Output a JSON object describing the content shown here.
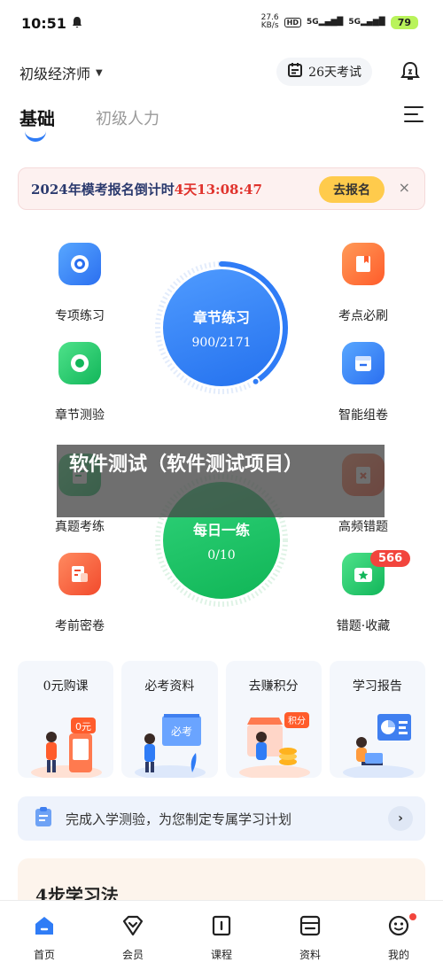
{
  "status_bar": {
    "time": "10:51",
    "net_speed": "27.6",
    "net_unit": "KB/s",
    "hd": "HD",
    "signal_1": "5G",
    "signal_2": "5G",
    "battery": "79"
  },
  "header": {
    "exam_selector": "初级经济师",
    "countdown": "26天考试"
  },
  "tabs": [
    {
      "label": "基础"
    },
    {
      "label": "初级人力"
    }
  ],
  "banner": {
    "text": "2024年模考报名倒计时",
    "time": "4天13:08:47",
    "button": "去报名",
    "close": "×"
  },
  "features": {
    "left": [
      {
        "label": "专项练习"
      },
      {
        "label": "章节测验"
      },
      {
        "label": "真题考练"
      },
      {
        "label": "考前密卷"
      }
    ],
    "right": [
      {
        "label": "考点必刷"
      },
      {
        "label": "智能组卷"
      },
      {
        "label": "高频错题"
      },
      {
        "label": "错题·收藏"
      }
    ]
  },
  "circles": {
    "chapter": {
      "title": "章节练习",
      "progress": "900/2171",
      "fraction": 0.41
    },
    "daily": {
      "title": "每日一练",
      "progress": "0/10",
      "fraction": 0
    }
  },
  "badge": "566",
  "watermark": "软件测试（软件测试项目）",
  "cards": [
    {
      "title": "0元购课",
      "tag": "0元"
    },
    {
      "title": "必考资料",
      "tag": "必考"
    },
    {
      "title": "去赚积分",
      "tag": "积分"
    },
    {
      "title": "学习报告",
      "tag": ""
    }
  ],
  "study_plan": {
    "text": "完成入学测验，为您制定专属学习计划",
    "arrow": "›"
  },
  "steps": {
    "title": "4步学习法"
  },
  "bottom_nav": [
    {
      "label": "首页"
    },
    {
      "label": "会员"
    },
    {
      "label": "课程"
    },
    {
      "label": "资料"
    },
    {
      "label": "我的"
    }
  ],
  "colors": {
    "accent_blue": "#2f7cf6",
    "accent_green": "#12b65a",
    "banner_red": "#e0322c",
    "banner_button": "#ffcb4c"
  }
}
